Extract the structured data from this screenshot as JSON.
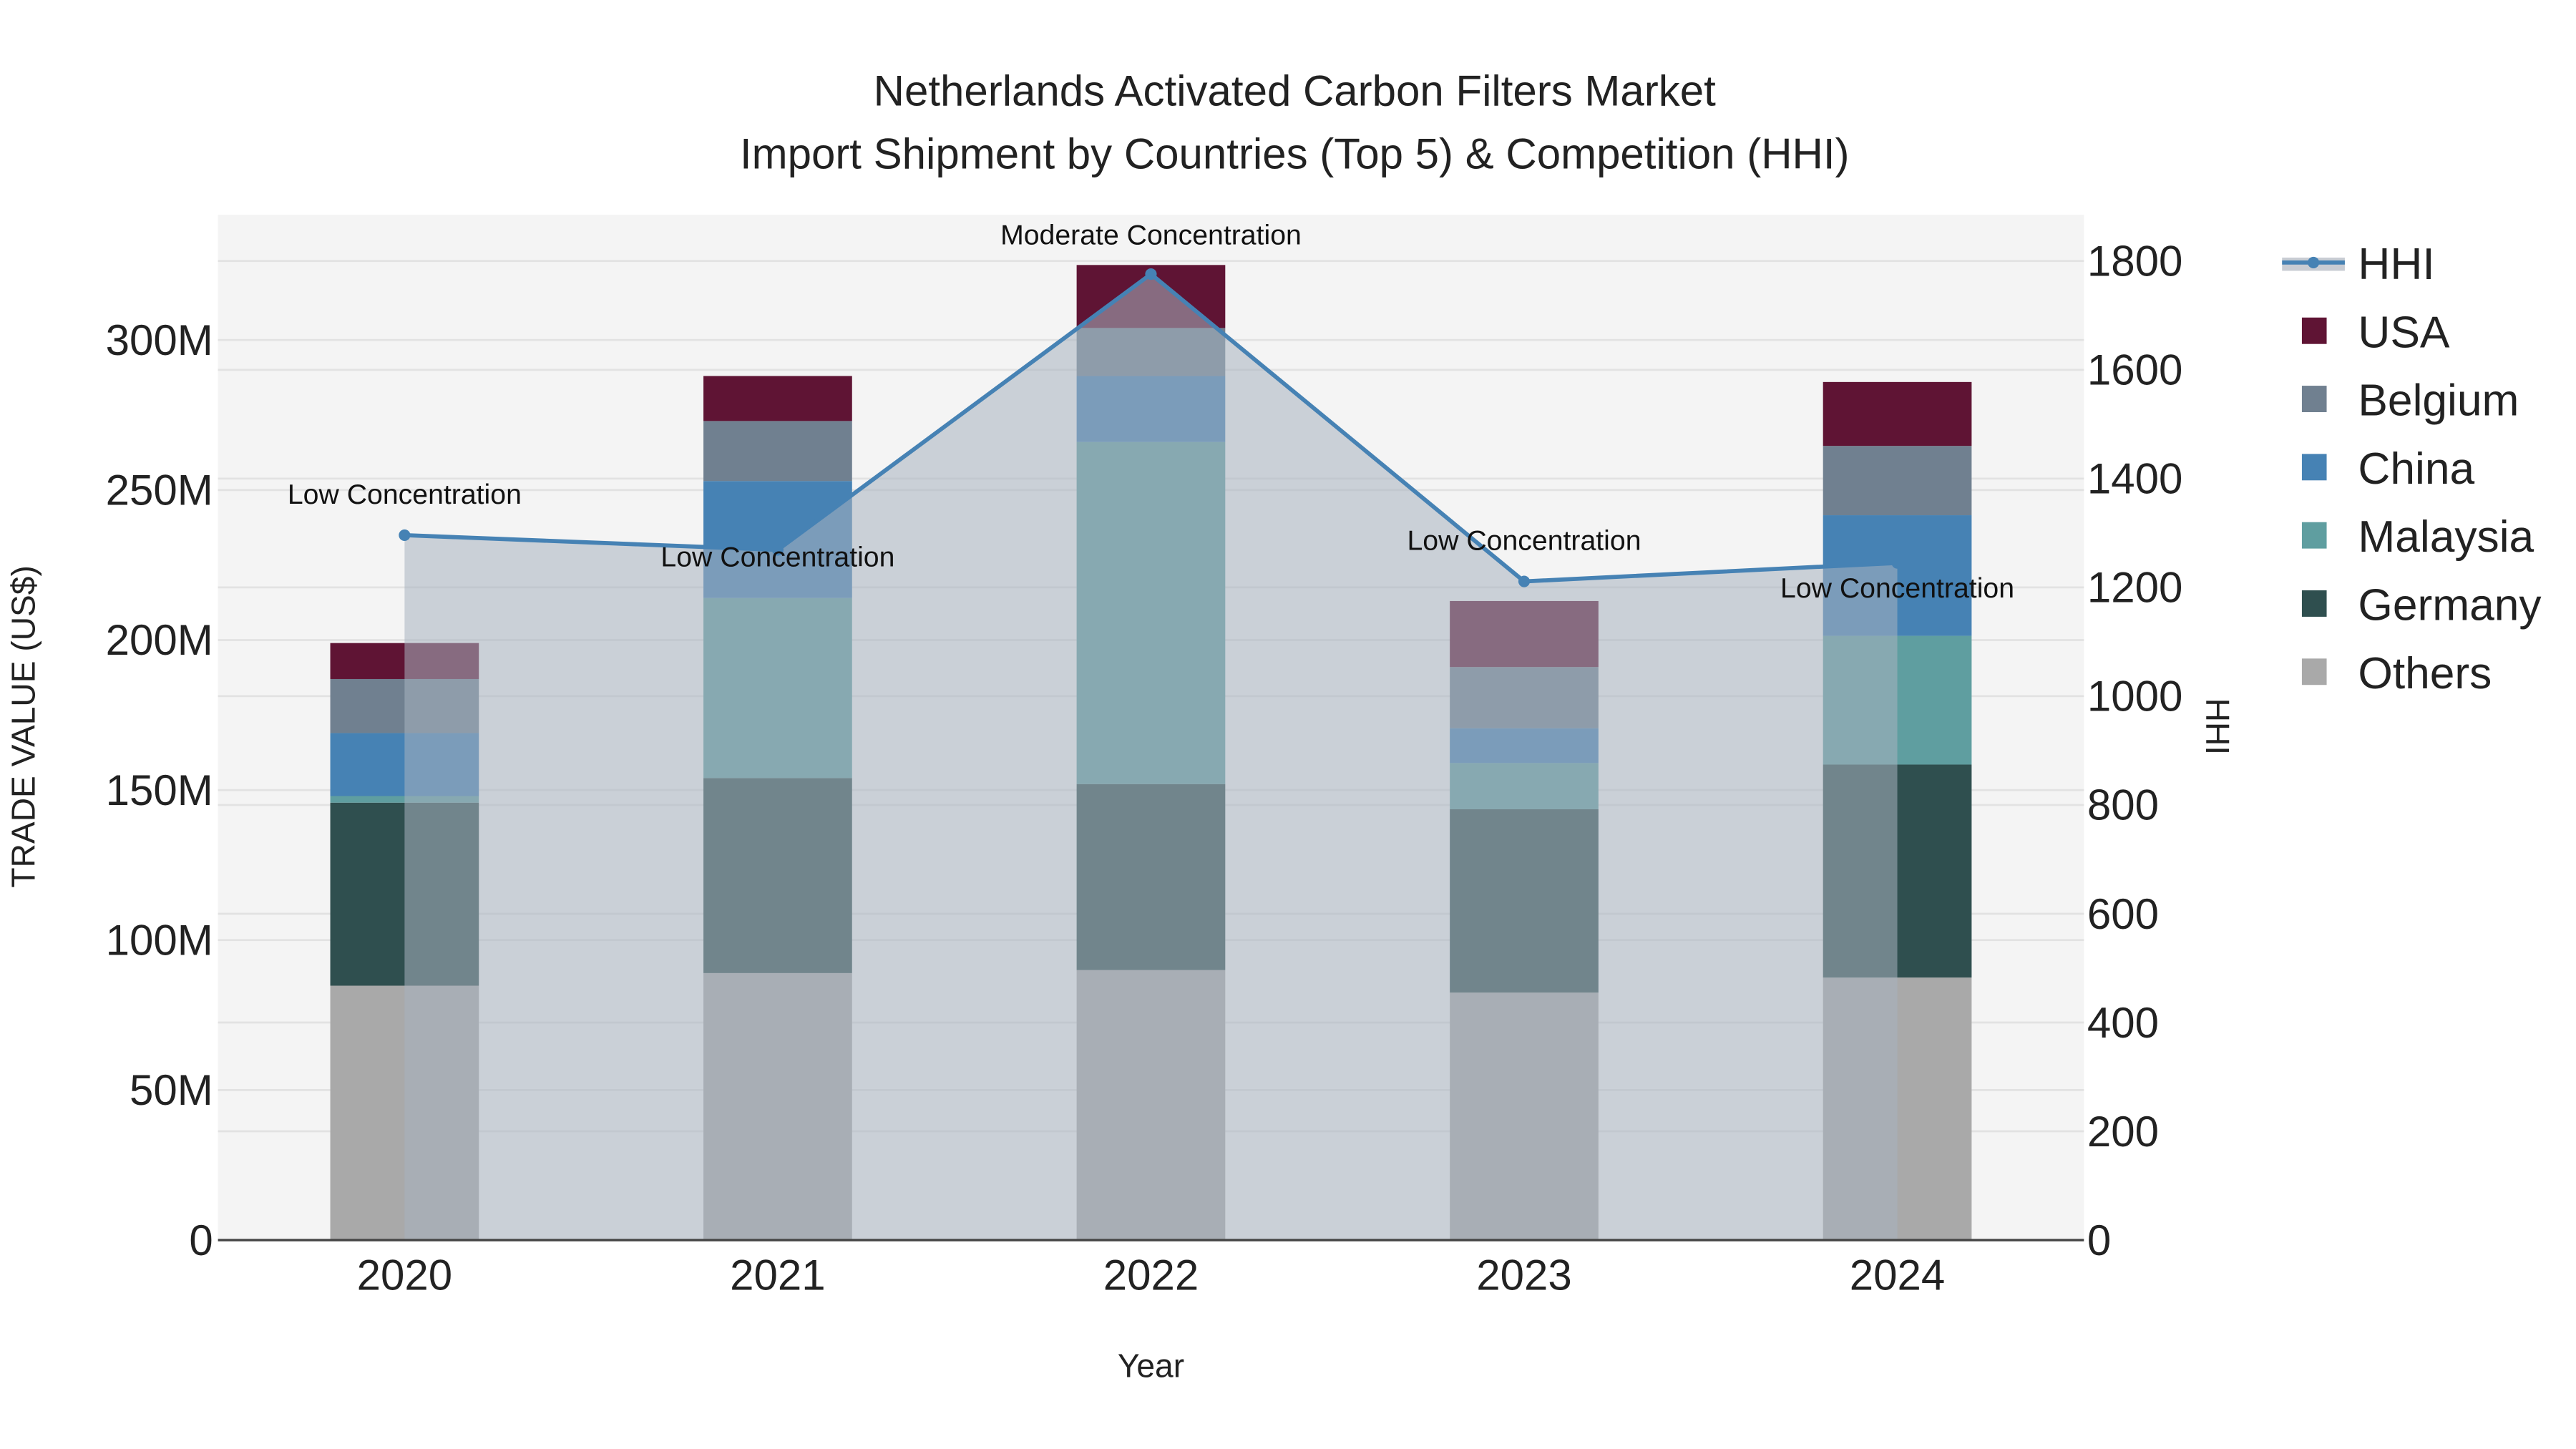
{
  "chart_data": {
    "type": "bar",
    "stacked": true,
    "title": "Netherlands Activated Carbon Filters Market",
    "subtitle": "Import Shipment by Countries (Top 5) & Competition (HHI)",
    "xlabel": "Year",
    "ylabel": "TRADE VALUE (US$)",
    "y2label": "HHI",
    "categories": [
      "2020",
      "2021",
      "2022",
      "2023",
      "2024"
    ],
    "ylim": [
      0,
      340000000
    ],
    "y2lim": [
      0,
      1880
    ],
    "yticks": [
      {
        "v": 0,
        "label": "0"
      },
      {
        "v": 50000000,
        "label": "50M"
      },
      {
        "v": 100000000,
        "label": "100M"
      },
      {
        "v": 150000000,
        "label": "150M"
      },
      {
        "v": 200000000,
        "label": "200M"
      },
      {
        "v": 250000000,
        "label": "250M"
      },
      {
        "v": 300000000,
        "label": "300M"
      }
    ],
    "y2ticks": [
      0,
      200,
      400,
      600,
      800,
      1000,
      1200,
      1400,
      1600,
      1800
    ],
    "series": [
      {
        "name": "Others",
        "color": "#a9a9a9",
        "values": [
          84800000,
          89000000,
          90000000,
          82500000,
          87500000
        ]
      },
      {
        "name": "Germany",
        "color": "#2f4f4f",
        "values": [
          61000000,
          65000000,
          62000000,
          61100000,
          71000000
        ]
      },
      {
        "name": "Malaysia",
        "color": "#5f9ea0",
        "values": [
          2200000,
          60000000,
          114000000,
          15400000,
          42900000
        ]
      },
      {
        "name": "China",
        "color": "#4682b4",
        "values": [
          21000000,
          39000000,
          22000000,
          11600000,
          40200000
        ]
      },
      {
        "name": "Belgium",
        "color": "#708090",
        "values": [
          18000000,
          20000000,
          16000000,
          20400000,
          23100000
        ]
      },
      {
        "name": "USA",
        "color": "#5f1434",
        "values": [
          12000000,
          15000000,
          21000000,
          22000000,
          21300000
        ]
      }
    ],
    "hhi": {
      "name": "HHI",
      "color": "#4682b4",
      "values": [
        1296,
        1269,
        1776,
        1211,
        1245
      ],
      "annotations": [
        "Low Concentration",
        "Low Concentration",
        "Moderate Concentration",
        "Low Concentration",
        "Low Concentration"
      ]
    },
    "legend": {
      "placement": "right",
      "items": [
        "HHI",
        "USA",
        "Belgium",
        "China",
        "Malaysia",
        "Germany",
        "Others"
      ]
    },
    "grid": true
  }
}
